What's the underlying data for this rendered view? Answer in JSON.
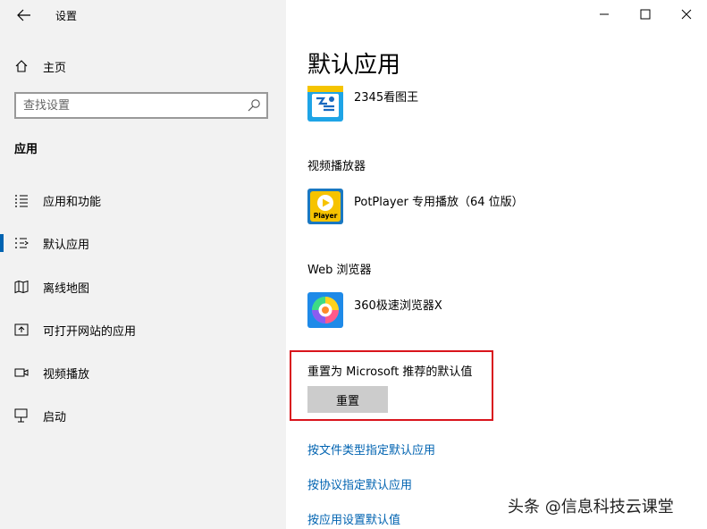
{
  "window": {
    "title": "设置",
    "controls": [
      "minimize-icon",
      "maximize-icon",
      "close-icon"
    ]
  },
  "sidebar": {
    "home_label": "主页",
    "search": {
      "placeholder": "查找设置",
      "value": ""
    },
    "section_title": "应用",
    "items": [
      {
        "label": "应用和功能",
        "icon": "apps-features-icon",
        "selected": false
      },
      {
        "label": "默认应用",
        "icon": "default-apps-icon",
        "selected": true
      },
      {
        "label": "离线地图",
        "icon": "offline-maps-icon",
        "selected": false
      },
      {
        "label": "可打开网站的应用",
        "icon": "apps-for-websites-icon",
        "selected": false
      },
      {
        "label": "视频播放",
        "icon": "video-playback-icon",
        "selected": false
      },
      {
        "label": "启动",
        "icon": "startup-icon",
        "selected": false
      }
    ]
  },
  "main": {
    "page_title": "默认应用",
    "photo_viewer": {
      "app_name": "2345看图王",
      "icon": "2345-viewer-icon"
    },
    "video_player": {
      "label": "视频播放器",
      "app_name": "PotPlayer 专用播放（64 位版）",
      "icon": "potplayer-icon",
      "icon_text": "Player"
    },
    "web_browser": {
      "label": "Web 浏览器",
      "app_name": "360极速浏览器X",
      "icon": "360-browser-icon"
    },
    "reset": {
      "label": "重置为 Microsoft 推荐的默认值",
      "button_label": "重置"
    },
    "links": [
      "按文件类型指定默认应用",
      "按协议指定默认应用",
      "按应用设置默认值"
    ]
  },
  "watermark": "头条 @信息科技云课堂",
  "colors": {
    "sidebar_bg": "#f2f2f2",
    "accent": "#0063b1",
    "highlight_border": "#d9141c",
    "button_bg": "#cccccc"
  }
}
